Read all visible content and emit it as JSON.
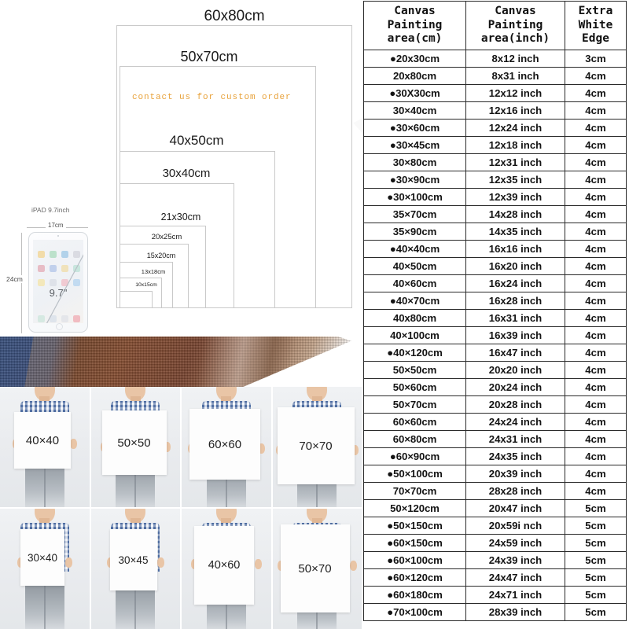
{
  "size_diagram": {
    "nested_sizes": [
      {
        "label": "60x80cm"
      },
      {
        "label": "50x70cm"
      },
      {
        "label": "40x50cm"
      },
      {
        "label": "30x40cm"
      },
      {
        "label": "21x30cm"
      },
      {
        "label": "20x25cm"
      },
      {
        "label": "15x20cm"
      },
      {
        "label": "13x18cm"
      },
      {
        "label": "10x15cm"
      }
    ],
    "custom_order_note": "contact us for  custom  order",
    "note_color": "#e8a33d"
  },
  "ipad_reference": {
    "caption": "iPAD 9.7inch",
    "width_label": "17cm",
    "height_label": "24cm",
    "diagonal_label": "9.7\""
  },
  "photo_grid": {
    "cells": [
      {
        "label": "40×40"
      },
      {
        "label": "50×50"
      },
      {
        "label": "60×60"
      },
      {
        "label": "70×70"
      },
      {
        "label": "30×40"
      },
      {
        "label": "30×45"
      },
      {
        "label": "40×60"
      },
      {
        "label": "50×70"
      }
    ]
  },
  "size_table": {
    "headers": {
      "cm": "Canvas Painting area(cm)",
      "inch": "Canvas Painting area(inch)",
      "edge": "Extra White Edge"
    },
    "highlight_blue": "#8fb6dc",
    "highlight_cream": "#fbeccc",
    "rows": [
      {
        "cm": "●20x30cm",
        "inch": "8x12 inch",
        "edge": "3cm",
        "highlight": "blue"
      },
      {
        "cm": "20x80cm",
        "inch": "8x31 inch",
        "edge": "4cm",
        "highlight": "none"
      },
      {
        "cm": "●30X30cm",
        "inch": "12x12 inch",
        "edge": "4cm",
        "highlight": "none"
      },
      {
        "cm": "30×40cm",
        "inch": "12x16 inch",
        "edge": "4cm",
        "highlight": "none",
        "tall": true
      },
      {
        "cm": "●30×60cm",
        "inch": "12x24 inch",
        "edge": "4cm",
        "highlight": "none"
      },
      {
        "cm": "●30×45cm",
        "inch": "12x18 inch",
        "edge": "4cm",
        "highlight": "none"
      },
      {
        "cm": "30×80cm",
        "inch": "12x31 inch",
        "edge": "4cm",
        "highlight": "none"
      },
      {
        "cm": "●30×90cm",
        "inch": "12x35 inch",
        "edge": "4cm",
        "highlight": "none"
      },
      {
        "cm": "●30×100cm",
        "inch": "12x39 inch",
        "edge": "4cm",
        "highlight": "none"
      },
      {
        "cm": "35×70cm",
        "inch": "14x28 inch",
        "edge": "4cm",
        "highlight": "none"
      },
      {
        "cm": "35×90cm",
        "inch": "14x35 inch",
        "edge": "4cm",
        "highlight": "none"
      },
      {
        "cm": "●40×40cm",
        "inch": "16x16 inch",
        "edge": "4cm",
        "highlight": "none"
      },
      {
        "cm": "40×50cm",
        "inch": "16x20 inch",
        "edge": "4cm",
        "highlight": "none"
      },
      {
        "cm": "40×60cm",
        "inch": "16x24 inch",
        "edge": "4cm",
        "highlight": "none"
      },
      {
        "cm": "●40×70cm",
        "inch": "16x28 inch",
        "edge": "4cm",
        "highlight": "none"
      },
      {
        "cm": "40x80cm",
        "inch": "16x31 inch",
        "edge": "4cm",
        "highlight": "none"
      },
      {
        "cm": "40×100cm",
        "inch": "16x39 inch",
        "edge": "4cm",
        "highlight": "none"
      },
      {
        "cm": "●40×120cm",
        "inch": "16x47 inch",
        "edge": "4cm",
        "highlight": "none"
      },
      {
        "cm": "50×50cm",
        "inch": "20x20 inch",
        "edge": "4cm",
        "highlight": "none"
      },
      {
        "cm": "50×60cm",
        "inch": "20x24 inch",
        "edge": "4cm",
        "highlight": "none"
      },
      {
        "cm": "50×70cm",
        "inch": "20x28 inch",
        "edge": "4cm",
        "highlight": "none"
      },
      {
        "cm": "60×60cm",
        "inch": "24x24 inch",
        "edge": "4cm",
        "highlight": "none"
      },
      {
        "cm": "60×80cm",
        "inch": "24x31 inch",
        "edge": "4cm",
        "highlight": "none"
      },
      {
        "cm": "●60×90cm",
        "inch": "24x35 inch",
        "edge": "4cm",
        "highlight": "none"
      },
      {
        "cm": "●50×100cm",
        "inch": "20x39 inch",
        "edge": "4cm",
        "highlight": "none"
      },
      {
        "cm": "70×70cm",
        "inch": "28x28 inch",
        "edge": "4cm",
        "highlight": "none"
      },
      {
        "cm": "50×120cm",
        "inch": "20x47 inch",
        "edge": "5cm",
        "highlight": "cream"
      },
      {
        "cm": "●50×150cm",
        "inch": "20x59i nch",
        "edge": "5cm",
        "highlight": "cream"
      },
      {
        "cm": "●60×150cm",
        "inch": "24x59 inch",
        "edge": "5cm",
        "highlight": "cream"
      },
      {
        "cm": "●60×100cm",
        "inch": "24x39 inch",
        "edge": "5cm",
        "highlight": "cream"
      },
      {
        "cm": "●60×120cm",
        "inch": "24x47 inch",
        "edge": "5cm",
        "highlight": "cream"
      },
      {
        "cm": "●60×180cm",
        "inch": "24x71 inch",
        "edge": "5cm",
        "highlight": "cream"
      },
      {
        "cm": "●70×100cm",
        "inch": "28x39 inch",
        "edge": "5cm",
        "highlight": "cream"
      }
    ]
  }
}
